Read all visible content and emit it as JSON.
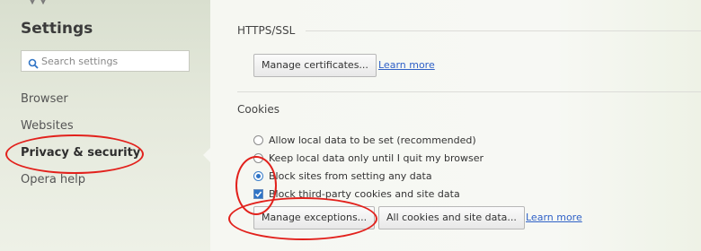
{
  "sidebar": {
    "title": "Settings",
    "search": {
      "placeholder": "Search settings",
      "value": ""
    },
    "items": [
      {
        "label": "Browser",
        "active": false
      },
      {
        "label": "Websites",
        "active": false
      },
      {
        "label": "Privacy & security",
        "active": true
      },
      {
        "label": "Opera help",
        "active": false
      }
    ]
  },
  "main": {
    "https": {
      "title": "HTTPS/SSL",
      "manage_certificates_label": "Manage certificates...",
      "learn_more": "Learn more"
    },
    "cookies": {
      "title": "Cookies",
      "options": [
        {
          "label": "Allow local data to be set (recommended)",
          "type": "radio",
          "checked": false
        },
        {
          "label": "Keep local data only until I quit my browser",
          "type": "radio",
          "checked": false
        },
        {
          "label": "Block sites from setting any data",
          "type": "radio",
          "checked": true
        },
        {
          "label": "Block third-party cookies and site data",
          "type": "checkbox",
          "checked": true
        }
      ],
      "manage_exceptions_label": "Manage exceptions...",
      "all_cookies_label": "All cookies and site data...",
      "learn_more": "Learn more"
    }
  },
  "annotation_color": "#e2211c",
  "accent_color": "#2f74c6"
}
